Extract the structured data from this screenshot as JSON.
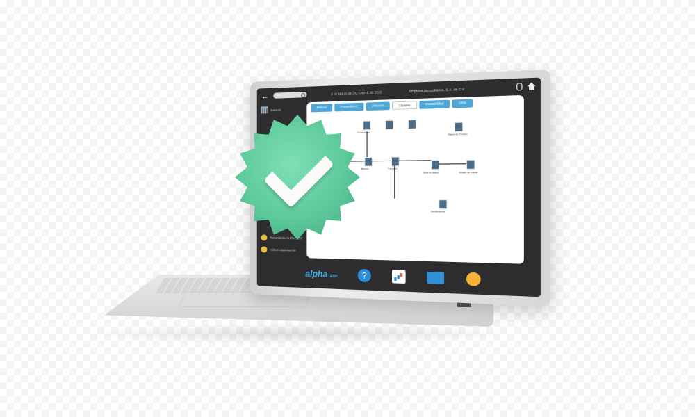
{
  "screen": {
    "topbar": {
      "date_text": "8 de Marzo de OCTUBRE de 2022",
      "company_text": "Empresa demostrativa, S.A. de C.V."
    },
    "sidebar": {
      "items": [
        {
          "label": "Bancos",
          "icon": "bank-icon"
        }
      ],
      "bottom_items": [
        {
          "label": "Recordando ALPHA ERP",
          "icon": "info-icon"
        },
        {
          "label": "Videos capacitación",
          "icon": "play-icon"
        }
      ]
    },
    "panel": {
      "tabs": [
        {
          "label": "Bancos",
          "active": false
        },
        {
          "label": "Proveedores",
          "active": false
        },
        {
          "label": "Almacén",
          "active": false
        },
        {
          "label": "Clientes",
          "active": true
        },
        {
          "label": "Contabilidad",
          "active": false
        },
        {
          "label": "CRM",
          "active": false
        }
      ],
      "flow_labels": [
        "Cotizaciones",
        "Remisiones",
        "Facturas",
        "Pagos de 1ª mayo",
        "Bancos",
        "Nota de crédito",
        "Devoluciones",
        "Estado de cuenta"
      ]
    },
    "dock": {
      "logo_text": "alpha",
      "logo_sub": "ERP",
      "icons": [
        "help-icon",
        "chart-icon",
        "grid-icon",
        "exit-icon"
      ]
    }
  },
  "badge": {
    "color": "#5cc89a",
    "icon": "checkmark-icon"
  }
}
